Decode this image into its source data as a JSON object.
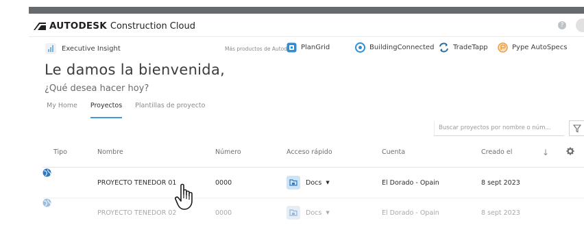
{
  "colors": {
    "top_bar": "#666a6e",
    "accent": "#3b9ad8",
    "plangrid": "#2b8fd6",
    "buildingconnected": "#2b8fd6",
    "tradetapp": "#2f6f9f",
    "pype": "#f29a3c",
    "globe": "#2d7ac4"
  },
  "header": {
    "brand": "AUTODESK",
    "product": "Construction Cloud",
    "help_symbol": "?"
  },
  "products_bar": {
    "executive_insight": "Executive Insight",
    "more_label": "Más productos de Autodesk",
    "items": [
      {
        "label": "PlanGrid",
        "icon": "plangrid-icon"
      },
      {
        "label": "BuildingConnected",
        "icon": "buildingconnected-icon"
      },
      {
        "label": "TradeTapp",
        "icon": "tradetapp-icon"
      },
      {
        "label": "Pype AutoSpecs",
        "icon": "pype-icon"
      }
    ]
  },
  "welcome": {
    "title": "Le damos la bienvenida,",
    "subtitle": "¿Qué desea hacer hoy?"
  },
  "tabs": [
    {
      "label": "My Home",
      "active": false
    },
    {
      "label": "Proyectos",
      "active": true
    },
    {
      "label": "Plantillas de proyecto",
      "active": false
    }
  ],
  "search": {
    "placeholder": "Buscar proyectos por nombre o núm..."
  },
  "table": {
    "columns": {
      "tipo": "Tipo",
      "nombre": "Nombre",
      "numero": "Número",
      "acceso": "Acceso rápido",
      "cuenta": "Cuenta",
      "creado": "Creado el",
      "sort_symbol": "↓"
    },
    "rows": [
      {
        "nombre": "PROYECTO TENEDOR 01",
        "numero": "0000",
        "acceso": "Docs",
        "cuenta": "El Dorado - Opain",
        "creado": "8 sept 2023"
      },
      {
        "nombre": "PROYECTO TENEDOR 02",
        "numero": "0000",
        "acceso": "Docs",
        "cuenta": "El Dorado - Opain",
        "creado": "8 sept 2023"
      }
    ]
  }
}
